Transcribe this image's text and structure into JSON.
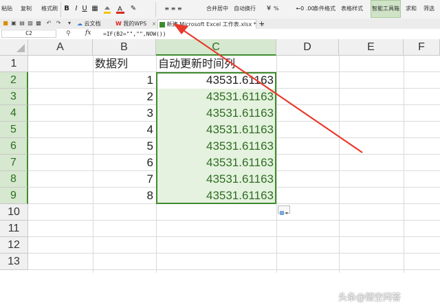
{
  "ribbon": {
    "paste": "粘贴",
    "copy": "复制",
    "format_painter": "格式刷",
    "bold": "B",
    "italic": "I",
    "underline": "U",
    "merge_center": "合并居中",
    "wrap_text": "自动换行",
    "percent": "%",
    "conditional_format": "条件格式",
    "table_style": "表格样式",
    "smart_toolbox": "智能工具箱",
    "sum": "求和",
    "filter": "筛选"
  },
  "tabbar": {
    "cloud_docs": "云文档",
    "my_wps": "我的WPS",
    "active_tab": "新建 Microsoft Excel 工作表.xlsx *",
    "new_tab": "+"
  },
  "formula_bar": {
    "name_box": "C2",
    "fx": "fx",
    "formula": "=IF(B2=\"\",\"\",NOW())"
  },
  "sheet": {
    "columns": [
      "A",
      "B",
      "C",
      "D",
      "E",
      "F"
    ],
    "rows": [
      "1",
      "2",
      "3",
      "4",
      "5",
      "6",
      "7",
      "8",
      "9",
      "10",
      "11",
      "12",
      "13"
    ],
    "b_header": "数据列",
    "c_header": "自动更新时间列",
    "b_values": [
      "1",
      "2",
      "3",
      "4",
      "5",
      "6",
      "7",
      "8"
    ],
    "c_values": [
      "43531.61163",
      "43531.61163",
      "43531.61163",
      "43531.61163",
      "43531.61163",
      "43531.61163",
      "43531.61163",
      "43531.61163"
    ],
    "selected_column": "C",
    "selected_range_color": "#3e8a2e",
    "selection_fill": "#e5f2df"
  },
  "annotation": {
    "arrow_color": "#e8392a"
  },
  "watermark": "头条@悟空问答"
}
